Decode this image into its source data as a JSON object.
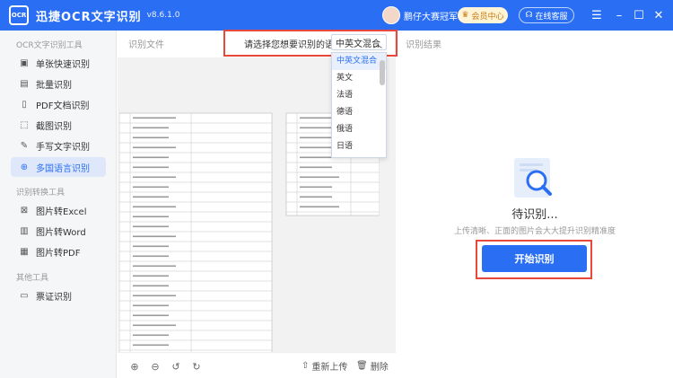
{
  "app": {
    "logo_text": "OCR",
    "name": "迅捷OCR文字识别",
    "version": "v8.6.1.0",
    "username": "鹏仔大赛冠军",
    "vip_label": "会员中心",
    "support_label": "在线客服"
  },
  "sidebar": {
    "section1": "OCR文字识别工具",
    "items1": [
      {
        "label": "单张快速识别",
        "icon": "image-icon"
      },
      {
        "label": "批量识别",
        "icon": "batch-icon"
      },
      {
        "label": "PDF文档识别",
        "icon": "pdf-icon"
      },
      {
        "label": "截图识别",
        "icon": "screenshot-icon"
      },
      {
        "label": "手写文字识别",
        "icon": "handwriting-icon"
      },
      {
        "label": "多国语言识别",
        "icon": "globe-icon"
      }
    ],
    "section2": "识别转换工具",
    "items2": [
      {
        "label": "图片转Excel",
        "icon": "excel-icon"
      },
      {
        "label": "图片转Word",
        "icon": "word-icon"
      },
      {
        "label": "图片转PDF",
        "icon": "pdf-icon"
      }
    ],
    "section3": "其他工具",
    "items3": [
      {
        "label": "票证识别",
        "icon": "ticket-icon"
      }
    ]
  },
  "center": {
    "title": "识别文件",
    "language_prompt": "请选择您想要识别的语种:",
    "language_selected": "中英文混合",
    "language_options": [
      "中英文混合",
      "英文",
      "法语",
      "德语",
      "俄语",
      "日语"
    ]
  },
  "toolbar": {
    "reupload_label": "重新上传",
    "delete_label": "删除"
  },
  "right": {
    "title": "识别结果",
    "status_title": "待识别...",
    "hint": "上传清晰、正面的图片会大大提升识别精准度",
    "start_label": "开始识别"
  },
  "colors": {
    "brand": "#2a6ff3",
    "highlight": "#e8483b"
  }
}
